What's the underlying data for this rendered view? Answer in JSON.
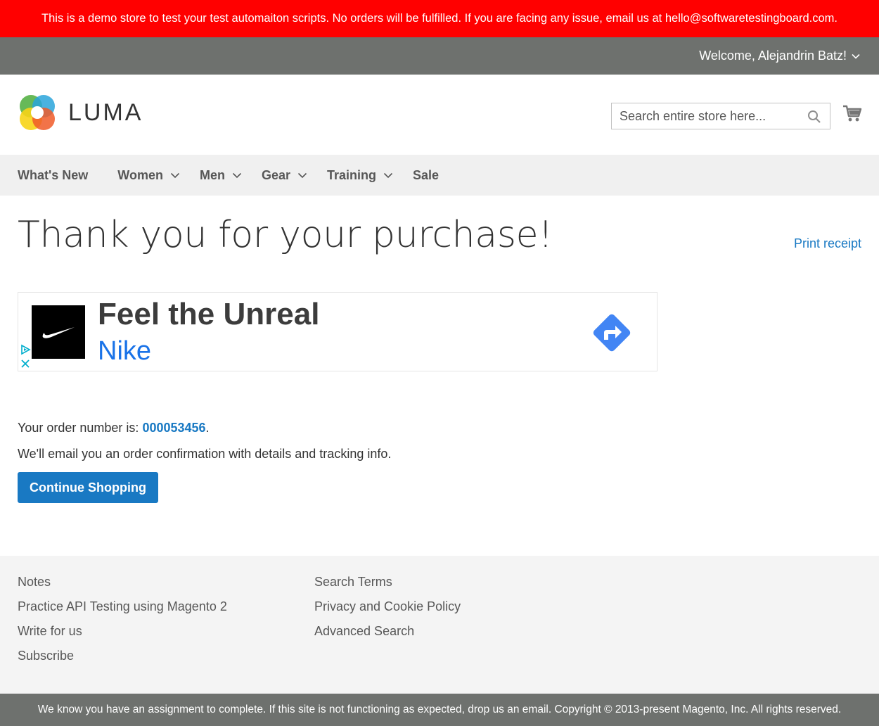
{
  "demo_notice": "This is a demo store to test your test automaiton scripts. No orders will be fulfilled. If you are facing any issue, email us at hello@softwaretestingboard.com.",
  "header": {
    "welcome": "Welcome, Alejandrin Batz!",
    "logo_text": "LUMA",
    "search_placeholder": "Search entire store here...",
    "search_value": ""
  },
  "nav": {
    "items": [
      {
        "label": "What's New",
        "has_dropdown": false
      },
      {
        "label": "Women",
        "has_dropdown": true
      },
      {
        "label": "Men",
        "has_dropdown": true
      },
      {
        "label": "Gear",
        "has_dropdown": true
      },
      {
        "label": "Training",
        "has_dropdown": true
      },
      {
        "label": "Sale",
        "has_dropdown": false
      }
    ]
  },
  "main": {
    "title": "Thank you for your purchase!",
    "print_receipt": "Print receipt",
    "order_prefix": "Your order number is: ",
    "order_number": "000053456",
    "order_suffix": ".",
    "email_text": "We'll email you an order confirmation with details and tracking info.",
    "continue_label": "Continue Shopping"
  },
  "ad": {
    "headline": "Feel the Unreal",
    "brand": "Nike",
    "icons": [
      "nike-swoosh-logo",
      "ad-choices-icon",
      "close-icon",
      "directions-icon"
    ]
  },
  "footer": {
    "col1": [
      "Notes",
      "Practice API Testing using Magento 2",
      "Write for us",
      "Subscribe"
    ],
    "col2": [
      "Search Terms",
      "Privacy and Cookie Policy",
      "Advanced Search"
    ]
  },
  "copyright": "We know you have an assignment to complete. If this site is not functioning as expected, drop us an email. Copyright © 2013-present Magento, Inc. All rights reserved.",
  "colors": {
    "demo_banner": "#ff0000",
    "header_bar": "#6e716e",
    "nav_bar": "#f0f0f0",
    "link_blue": "#1979c3",
    "footer_bg": "#f4f4f4",
    "ad_brand_blue": "#1a73e8"
  }
}
